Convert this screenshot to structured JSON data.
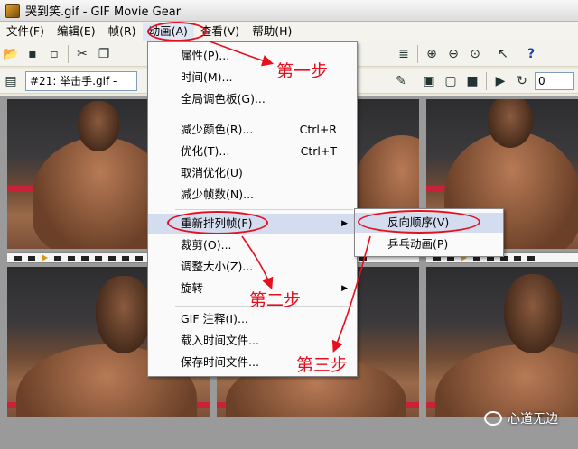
{
  "window": {
    "title": "哭到笑.gif - GIF Movie Gear"
  },
  "menubar": {
    "items": [
      {
        "label": "文件(F)"
      },
      {
        "label": "编辑(E)"
      },
      {
        "label": "帧(R)"
      },
      {
        "label": "动画(A)"
      },
      {
        "label": "查看(V)"
      },
      {
        "label": "帮助(H)"
      }
    ]
  },
  "toolbar2": {
    "frame_combo_value": "#21: 举击手.gif - ",
    "spin_value": "0"
  },
  "animation_menu": {
    "items": [
      {
        "label": "属性(P)..."
      },
      {
        "label": "时间(M)..."
      },
      {
        "label": "全局调色板(G)..."
      },
      {
        "label": "减少颜色(R)...",
        "shortcut": "Ctrl+R"
      },
      {
        "label": "优化(T)...",
        "shortcut": "Ctrl+T"
      },
      {
        "label": "取消优化(U)"
      },
      {
        "label": "减少帧数(N)..."
      },
      {
        "label": "重新排列帧(F)"
      },
      {
        "label": "裁剪(O)..."
      },
      {
        "label": "调整大小(Z)..."
      },
      {
        "label": "旋转"
      },
      {
        "label": "GIF 注释(I)..."
      },
      {
        "label": "载入时间文件..."
      },
      {
        "label": "保存时间文件..."
      }
    ]
  },
  "reorder_submenu": {
    "items": [
      {
        "label": "反向顺序(V)"
      },
      {
        "label": "乒乓动画(P)"
      }
    ]
  },
  "annotations": {
    "step1": "第一步",
    "step2": "第二步",
    "step3": "第三步",
    "color": "#e4101e"
  },
  "watermark": {
    "text": "心道无边"
  }
}
